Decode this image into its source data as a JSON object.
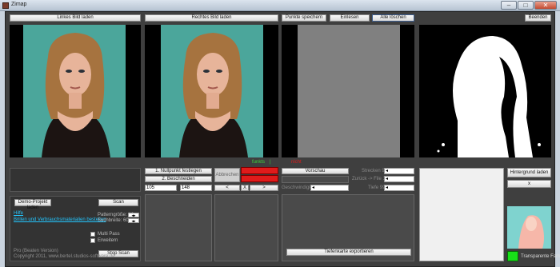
{
  "window": {
    "title": "Zimap",
    "minimize_glyph": "–",
    "maximize_glyph": "□",
    "close_glyph": "✕"
  },
  "toolbar": {
    "left_load": "Linkes Bild laden",
    "right_load": "Rechtes Bild laden",
    "save_points": "Punkte speichern",
    "read_in": "Einlesen",
    "delete_all": "Alle löschen",
    "quit": "Beenden"
  },
  "status": {
    "left": "funkts",
    "separator": "|",
    "right": "nicht"
  },
  "controls": {
    "zero_point": "1. Nullpunkt festlegen",
    "crop": "2. Beschneiden",
    "cancel": "Abbrechen",
    "preview": "Vorschau",
    "field1": "105",
    "field2": "148",
    "nav_left": "<",
    "nav_x": "X",
    "nav_right": ">",
    "sharpness_label": "Geschwindigkeit",
    "strength_label": "Strecken 99",
    "back_label": "Zurück -> File 1",
    "depth_label": "Tiefe 99",
    "export": "Tiefenkarte exportieren",
    "background_load": "Hintergrund laden",
    "background_x": "x",
    "transparent_color": "Transparente Farbe"
  },
  "project": {
    "load_demo": "Demo-Projekt laden",
    "scan": "Scan",
    "help_link": "Hilfe",
    "shop_link": "Brillen und Verbrauchsmaterialien bestellen",
    "pattern_size_label": "Patterngröße: 16",
    "search_width_label": "Suchbreite: 60",
    "multi_pass": "Multi Pass",
    "extend": "Erweitern",
    "stop_scan": "Stop Scan",
    "version": "Pro (Beaten Version)",
    "copyright": "Copyright 2011, www.bertel.studios-software.de"
  },
  "colors": {
    "accent_link": "#23c6ff",
    "red_indicator": "#e01b1b",
    "status_green": "#3bd13b"
  }
}
